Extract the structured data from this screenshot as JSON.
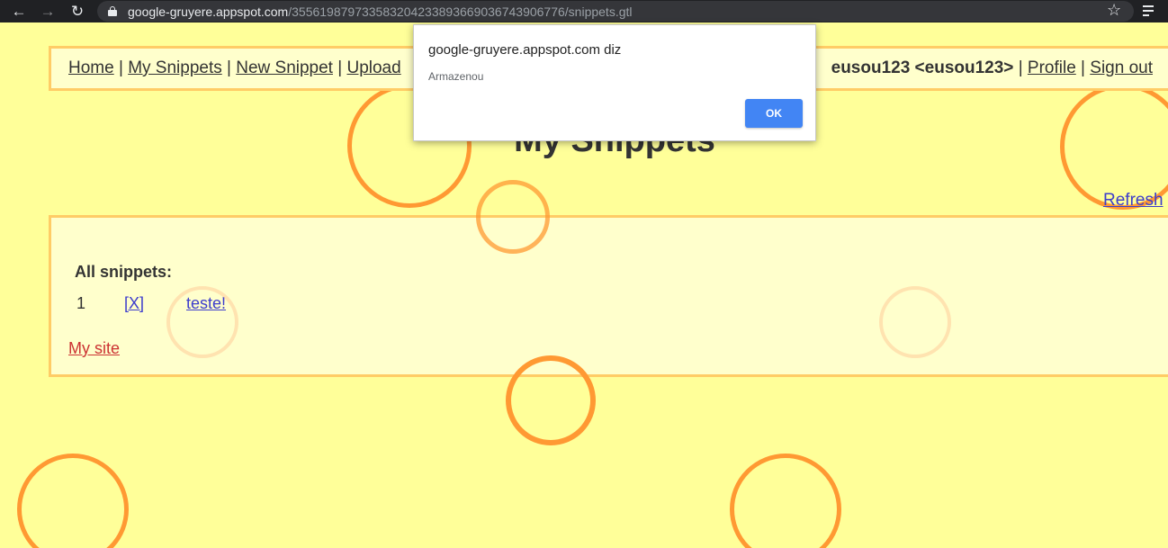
{
  "browser": {
    "url_host": "google-gruyere.appspot.com",
    "url_path": "/355619879733583204233893669036743906776/snippets.gtl",
    "icons": [
      "back-arrow-icon",
      "forward-arrow-icon",
      "reload-icon",
      "lock-icon",
      "star-icon",
      "media-control-icon"
    ]
  },
  "menu": {
    "home": "Home",
    "my_snippets": "My Snippets",
    "new_snippet": "New Snippet",
    "upload": "Upload",
    "separator": "|",
    "user": "eusou123 <eusou123>",
    "profile": "Profile",
    "sign_out": "Sign out"
  },
  "page": {
    "title": "My Snippets",
    "refresh": "Refresh"
  },
  "snippets": {
    "heading": "All snippets:",
    "rows": [
      {
        "num": "1",
        "delete": "[X]",
        "text": "teste!"
      }
    ],
    "my_site": "My site"
  },
  "dialog": {
    "origin": "google-gruyere.appspot.com diz",
    "message": "Armazenou",
    "ok": "OK"
  },
  "colors": {
    "background": "#ffff99",
    "panel": "#ffffcc",
    "panel_border": "#ffcc66",
    "circle": "#ff9933",
    "link": "#3d3dcc",
    "my_site_link": "#cc3333",
    "ok_button": "#4285f4"
  }
}
